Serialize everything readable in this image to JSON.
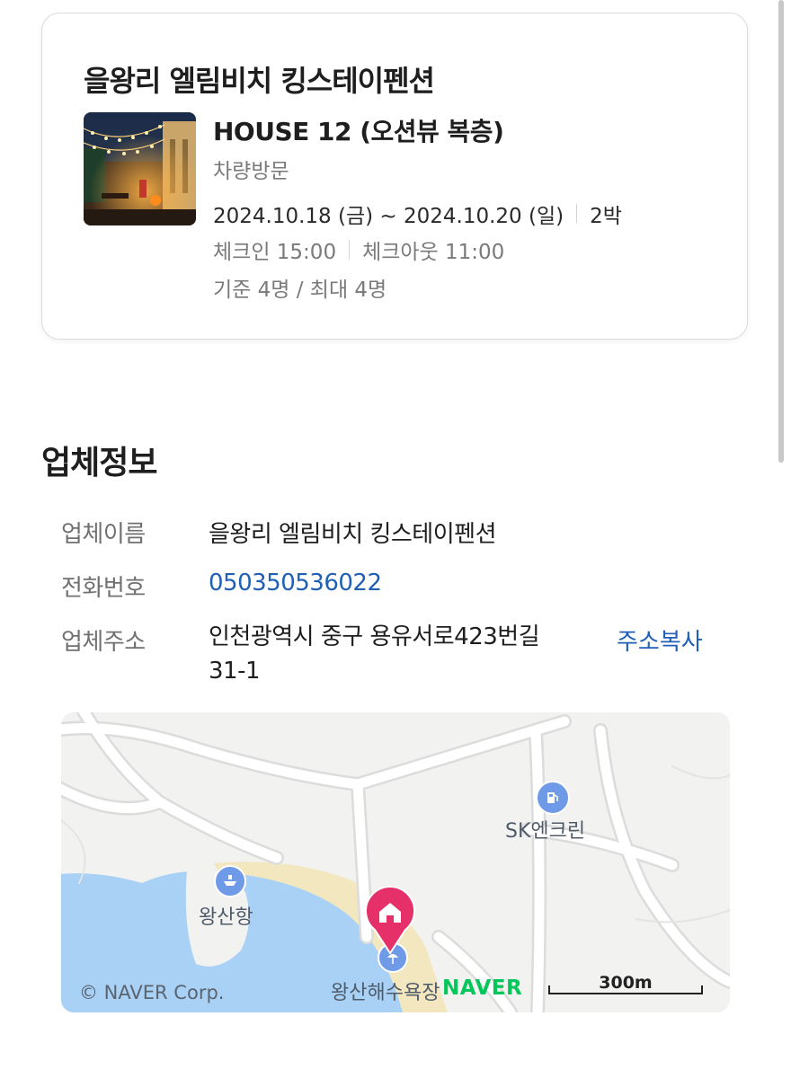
{
  "booking": {
    "property_name": "을왕리 엘림비치 킹스테이펜션",
    "room_name": "HOUSE 12 (오션뷰 복층)",
    "visit_type": "차량방문",
    "check_in_date": "2024.10.18 (금) ~ 2024.10.20 (일)",
    "nights": "2박",
    "check_in_time": "체크인 15:00",
    "check_out_time": "체크아웃 11:00",
    "capacity": "기준 4명 / 최대 4명"
  },
  "business": {
    "section_title": "업체정보",
    "name_label": "업체이름",
    "name_value": "을왕리 엘림비치 킹스테이펜션",
    "phone_label": "전화번호",
    "phone_value": "050350536022",
    "address_label": "업체주소",
    "address_value": "인천광역시 중구 용유서로423번길 31-1",
    "copy_address_button": "주소복사"
  },
  "map": {
    "labels": {
      "gas_station": "SK엔크린",
      "port": "왕산항",
      "beach": "왕산해수욕장"
    },
    "copyright": "© NAVER Corp.",
    "brand": "NAVER",
    "scale_text": "300m",
    "colors": {
      "water": "#a9d1f5",
      "land": "#f2f2f0",
      "road": "#ffffff",
      "sand": "#f3e7bf",
      "marker": "#e5306a"
    }
  },
  "icons": {
    "gas_station": "fuel-pump-icon",
    "port": "ship-icon",
    "beach": "beach-umbrella-icon",
    "marker": "home-marker-icon"
  }
}
